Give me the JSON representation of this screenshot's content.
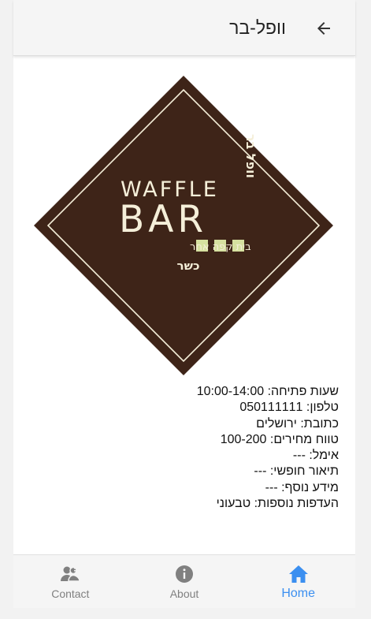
{
  "header": {
    "title": "וופל-בר",
    "back_icon": "arrow-back-icon"
  },
  "logo": {
    "brand_en_line1": "WAFFLE",
    "brand_en_line2": "BAR",
    "brand_he_vertical": "וופל בר",
    "tagline": "בית קפה אחר",
    "kosher": "כשר",
    "colors": {
      "background": "#3e2418",
      "text": "#f5efd9",
      "squares": "#d6e0a0"
    }
  },
  "details": {
    "hours_label": "שעות פתיחה:",
    "hours_value": "10:00-14:00",
    "phone_label": "טלפון:",
    "phone_value": "050111111",
    "address_label": "כתובת:",
    "address_value": "ירושלים",
    "price_label": "טווח מחירים:",
    "price_value": "100-200",
    "email_label": "אימל:",
    "email_value": "---",
    "description_label": "תיאור חופשי:",
    "description_value": "---",
    "more_label": "מידע נוסף:",
    "more_value": "---",
    "prefs_label": "העדפות נוספות:",
    "prefs_value": "טבעוני"
  },
  "bottom_nav": {
    "contact_label": "Contact",
    "contact_icon": "contacts-icon",
    "about_label": "About",
    "about_icon": "info-icon",
    "home_label": "Home",
    "home_icon": "home-icon",
    "active": "home",
    "active_color": "#3b8ff0",
    "inactive_color": "#808080"
  }
}
